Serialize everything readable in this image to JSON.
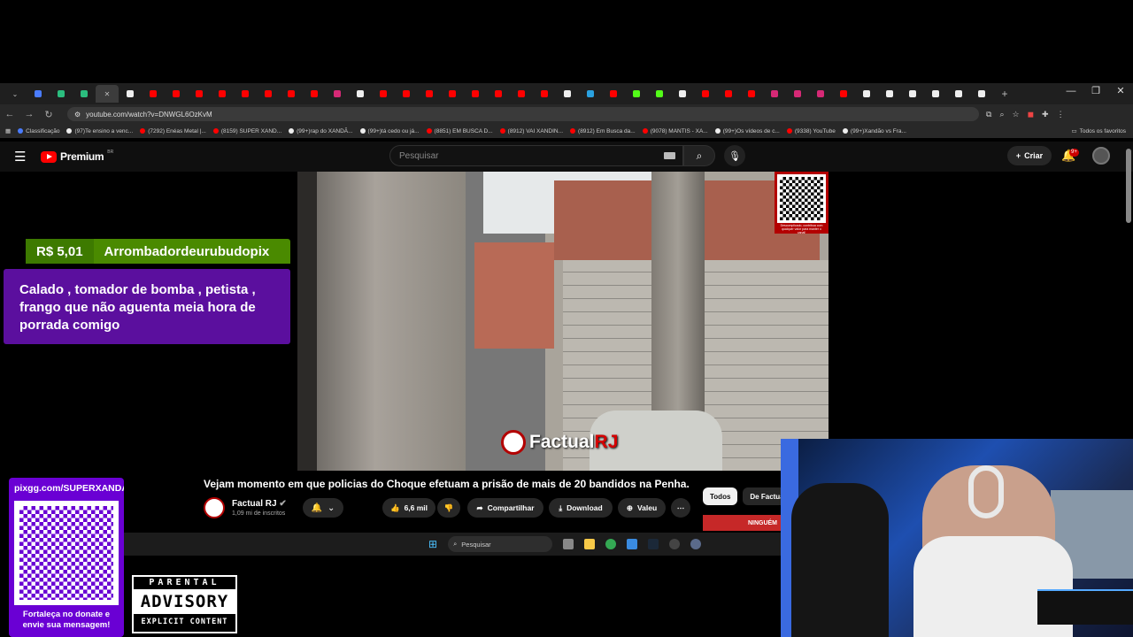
{
  "browser": {
    "tab_count_icons": [
      "youtube",
      "tiktok",
      "instagram",
      "telegram",
      "chrome"
    ],
    "url": "youtube.com/watch?v=DNWGL6OzKvM",
    "bookmarks": [
      "Classificação",
      "(97)Te ensino a venc...",
      "(7292) Enéas Metal |...",
      "(8159) SUPER XAND...",
      "(99+)rap do XANDÃ...",
      "(99+)tá cedo ou já...",
      "(8851) EM BUSCA D...",
      "(8912) VAI XANDIN...",
      "(8912) Em Busca da...",
      "(9078) MANTIS - XA...",
      "(99+)Os vídeos de c...",
      "(9338) YouTube",
      "(99+)Xandão vs Fra..."
    ],
    "all_bookmarks": "Todos os favoritos"
  },
  "youtube": {
    "logo": "Premium",
    "region": "BR",
    "search_placeholder": "Pesquisar",
    "create_label": "Criar",
    "notif_badge": "9+"
  },
  "video": {
    "brand": "Factual",
    "brand_accent": "RJ",
    "qr_caption": "Descomplicado, contribua com qualquer valor para manter o canal!",
    "title": "Vejam momento em que policias do Choque efetuam a prisão de mais de 20 bandidos na Penha.",
    "channel_name": "Factual RJ",
    "channel_subs": "1,09 mi de inscritos",
    "likes": "6,6 mil",
    "share_label": "Compartilhar",
    "download_label": "Download",
    "thanks_label": "Valeu",
    "chips": [
      "Todos",
      "De Factua"
    ],
    "next_thumb_text": "NINGUÉM"
  },
  "superchat": {
    "amount": "R$ 5,01",
    "name": "Arrombadordeurubudopix",
    "message": "Calado , tomador de bomba , petista , frango que não aguenta meia hora de porrada comigo"
  },
  "taskbar": {
    "search_placeholder": "Pesquisar"
  },
  "donation": {
    "url": "pixgg.com/SUPERXANDAO",
    "text": "Fortaleça no donate e envie sua mensagem!"
  },
  "advisory": {
    "top": "PARENTAL",
    "middle": "ADVISORY",
    "bottom": "EXPLICIT CONTENT"
  },
  "colors": {
    "youtube_red": "#ff0000",
    "superchat_green": "#4a8a00",
    "superchat_purple": "#5b0f9e",
    "donation_purple": "#6a00d4"
  }
}
